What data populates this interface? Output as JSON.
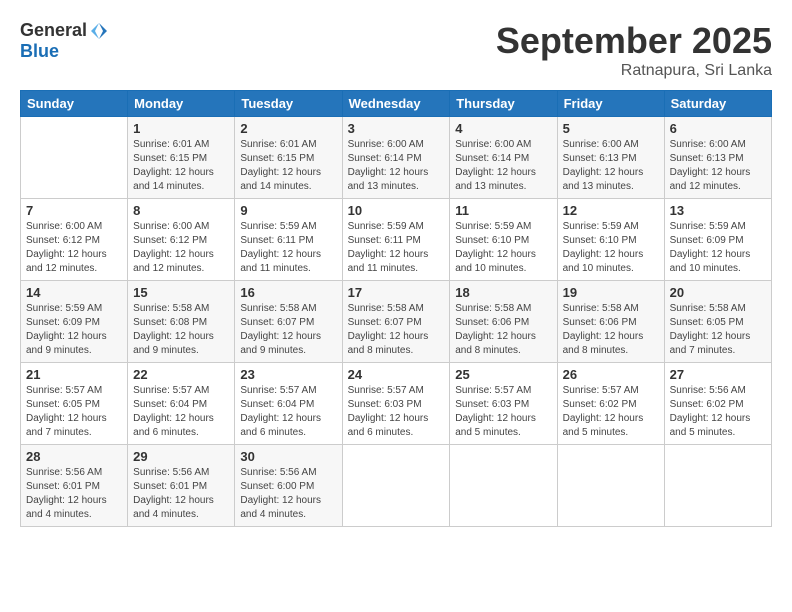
{
  "header": {
    "logo_general": "General",
    "logo_blue": "Blue",
    "month": "September 2025",
    "location": "Ratnapura, Sri Lanka"
  },
  "weekdays": [
    "Sunday",
    "Monday",
    "Tuesday",
    "Wednesday",
    "Thursday",
    "Friday",
    "Saturday"
  ],
  "weeks": [
    [
      {
        "day": "",
        "info": ""
      },
      {
        "day": "1",
        "info": "Sunrise: 6:01 AM\nSunset: 6:15 PM\nDaylight: 12 hours\nand 14 minutes."
      },
      {
        "day": "2",
        "info": "Sunrise: 6:01 AM\nSunset: 6:15 PM\nDaylight: 12 hours\nand 14 minutes."
      },
      {
        "day": "3",
        "info": "Sunrise: 6:00 AM\nSunset: 6:14 PM\nDaylight: 12 hours\nand 13 minutes."
      },
      {
        "day": "4",
        "info": "Sunrise: 6:00 AM\nSunset: 6:14 PM\nDaylight: 12 hours\nand 13 minutes."
      },
      {
        "day": "5",
        "info": "Sunrise: 6:00 AM\nSunset: 6:13 PM\nDaylight: 12 hours\nand 13 minutes."
      },
      {
        "day": "6",
        "info": "Sunrise: 6:00 AM\nSunset: 6:13 PM\nDaylight: 12 hours\nand 12 minutes."
      }
    ],
    [
      {
        "day": "7",
        "info": ""
      },
      {
        "day": "8",
        "info": "Sunrise: 6:00 AM\nSunset: 6:12 PM\nDaylight: 12 hours\nand 12 minutes."
      },
      {
        "day": "9",
        "info": "Sunrise: 5:59 AM\nSunset: 6:11 PM\nDaylight: 12 hours\nand 11 minutes."
      },
      {
        "day": "10",
        "info": "Sunrise: 5:59 AM\nSunset: 6:11 PM\nDaylight: 12 hours\nand 11 minutes."
      },
      {
        "day": "11",
        "info": "Sunrise: 5:59 AM\nSunset: 6:10 PM\nDaylight: 12 hours\nand 10 minutes."
      },
      {
        "day": "12",
        "info": "Sunrise: 5:59 AM\nSunset: 6:10 PM\nDaylight: 12 hours\nand 10 minutes."
      },
      {
        "day": "13",
        "info": "Sunrise: 5:59 AM\nSunset: 6:09 PM\nDaylight: 12 hours\nand 10 minutes."
      }
    ],
    [
      {
        "day": "14",
        "info": ""
      },
      {
        "day": "15",
        "info": "Sunrise: 5:58 AM\nSunset: 6:08 PM\nDaylight: 12 hours\nand 9 minutes."
      },
      {
        "day": "16",
        "info": "Sunrise: 5:58 AM\nSunset: 6:07 PM\nDaylight: 12 hours\nand 9 minutes."
      },
      {
        "day": "17",
        "info": "Sunrise: 5:58 AM\nSunset: 6:07 PM\nDaylight: 12 hours\nand 8 minutes."
      },
      {
        "day": "18",
        "info": "Sunrise: 5:58 AM\nSunset: 6:06 PM\nDaylight: 12 hours\nand 8 minutes."
      },
      {
        "day": "19",
        "info": "Sunrise: 5:58 AM\nSunset: 6:06 PM\nDaylight: 12 hours\nand 8 minutes."
      },
      {
        "day": "20",
        "info": "Sunrise: 5:58 AM\nSunset: 6:05 PM\nDaylight: 12 hours\nand 7 minutes."
      }
    ],
    [
      {
        "day": "21",
        "info": ""
      },
      {
        "day": "22",
        "info": "Sunrise: 5:57 AM\nSunset: 6:04 PM\nDaylight: 12 hours\nand 6 minutes."
      },
      {
        "day": "23",
        "info": "Sunrise: 5:57 AM\nSunset: 6:04 PM\nDaylight: 12 hours\nand 6 minutes."
      },
      {
        "day": "24",
        "info": "Sunrise: 5:57 AM\nSunset: 6:03 PM\nDaylight: 12 hours\nand 6 minutes."
      },
      {
        "day": "25",
        "info": "Sunrise: 5:57 AM\nSunset: 6:03 PM\nDaylight: 12 hours\nand 5 minutes."
      },
      {
        "day": "26",
        "info": "Sunrise: 5:57 AM\nSunset: 6:02 PM\nDaylight: 12 hours\nand 5 minutes."
      },
      {
        "day": "27",
        "info": "Sunrise: 5:56 AM\nSunset: 6:02 PM\nDaylight: 12 hours\nand 5 minutes."
      }
    ],
    [
      {
        "day": "28",
        "info": "Sunrise: 5:56 AM\nSunset: 6:01 PM\nDaylight: 12 hours\nand 4 minutes."
      },
      {
        "day": "29",
        "info": "Sunrise: 5:56 AM\nSunset: 6:01 PM\nDaylight: 12 hours\nand 4 minutes."
      },
      {
        "day": "30",
        "info": "Sunrise: 5:56 AM\nSunset: 6:00 PM\nDaylight: 12 hours\nand 4 minutes."
      },
      {
        "day": "",
        "info": ""
      },
      {
        "day": "",
        "info": ""
      },
      {
        "day": "",
        "info": ""
      },
      {
        "day": "",
        "info": ""
      }
    ]
  ],
  "week7_first_info": {
    "7": "Sunrise: 6:00 AM\nSunset: 6:12 PM\nDaylight: 12 hours\nand 12 minutes.",
    "14": "Sunrise: 5:59 AM\nSunset: 6:09 PM\nDaylight: 12 hours\nand 9 minutes.",
    "21": "Sunrise: 5:57 AM\nSunset: 6:05 PM\nDaylight: 12 hours\nand 7 minutes."
  }
}
